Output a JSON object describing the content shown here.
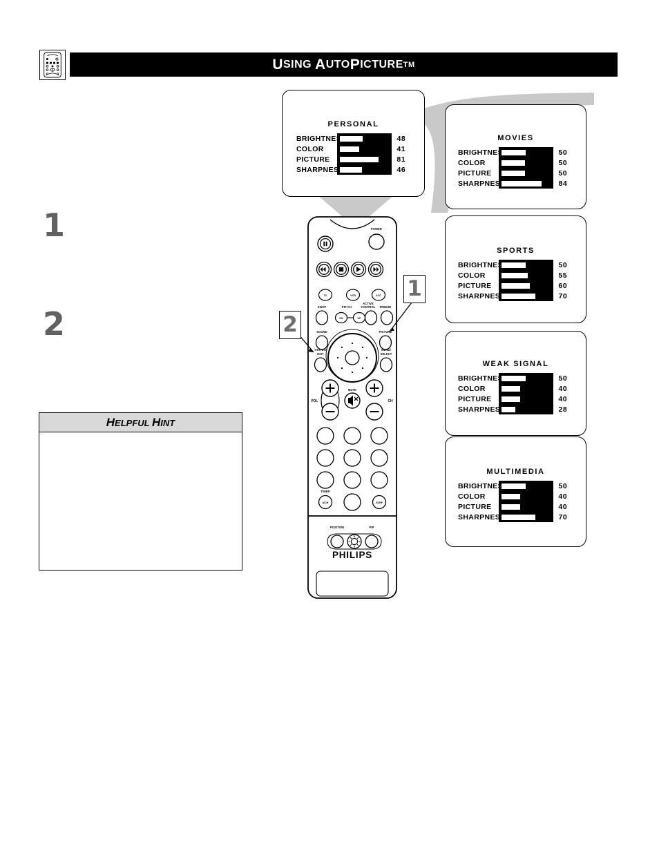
{
  "header": {
    "icon": "remote-control-icon",
    "title_parts": [
      "U",
      "SING ",
      "A",
      "UTO",
      "P",
      "ICTURE"
    ],
    "title": "USING AUTOPICTURE",
    "trademark": "TM",
    "bar_color": "#000000",
    "text_color": "#ffffff"
  },
  "steps": [
    {
      "number": "1",
      "text": ""
    },
    {
      "number": "2",
      "text": ""
    }
  ],
  "hint": {
    "title_parts": [
      "H",
      "ELPFUL ",
      "H",
      "INT"
    ],
    "title": "HELPFUL HINT",
    "body": "",
    "header_bg": "#d9d9d9"
  },
  "callouts": [
    {
      "label": "1",
      "target": "picture-button"
    },
    {
      "label": "2",
      "target": "status-exit-button"
    }
  ],
  "settings_columns": [
    "BRIGHTNESS",
    "COLOR",
    "PICTURE",
    "SHARPNESS"
  ],
  "panels": [
    {
      "id": "personal",
      "title": "PERSONAL",
      "rows": [
        {
          "label": "BRIGHTNESS",
          "value": 48
        },
        {
          "label": "COLOR",
          "value": 41
        },
        {
          "label": "PICTURE",
          "value": 81
        },
        {
          "label": "SHARPNESS",
          "value": 46
        }
      ]
    },
    {
      "id": "movies",
      "title": "MOVIES",
      "rows": [
        {
          "label": "BRIGHTNESS",
          "value": 50
        },
        {
          "label": "COLOR",
          "value": 50
        },
        {
          "label": "PICTURE",
          "value": 50
        },
        {
          "label": "SHARPNESS",
          "value": 84
        }
      ]
    },
    {
      "id": "sports",
      "title": "SPORTS",
      "rows": [
        {
          "label": "BRIGHTNESS",
          "value": 50
        },
        {
          "label": "COLOR",
          "value": 55
        },
        {
          "label": "PICTURE",
          "value": 60
        },
        {
          "label": "SHARPNESS",
          "value": 70
        }
      ]
    },
    {
      "id": "weak-signal",
      "title": "WEAK  SIGNAL",
      "rows": [
        {
          "label": "BRIGHTNESS",
          "value": 50
        },
        {
          "label": "COLOR",
          "value": 40
        },
        {
          "label": "PICTURE",
          "value": 40
        },
        {
          "label": "SHARPNESS",
          "value": 28
        }
      ]
    },
    {
      "id": "multimedia",
      "title": "MULTIMEDIA",
      "rows": [
        {
          "label": "BRIGHTNESS",
          "value": 50
        },
        {
          "label": "COLOR",
          "value": 40
        },
        {
          "label": "PICTURE",
          "value": 40
        },
        {
          "label": "SHARPNESS",
          "value": 70
        }
      ]
    }
  ],
  "remote": {
    "brand": "PHILIPS",
    "labels": {
      "power": "POWER",
      "tv": "TV",
      "vcr": "VCR",
      "acc": "ACC",
      "swap": "SWAP",
      "pip_ch": "PIP CH",
      "dn": "DN",
      "up": "UP",
      "active_control_1": "ACTIVE",
      "active_control_2": "CONTROL",
      "freeze": "FREEZE",
      "sound": "SOUND",
      "picture": "PICTURE",
      "status_1": "STATUS/",
      "status_2": "EXIT",
      "menu_1": "MENU/",
      "menu_2": "SELECT",
      "vol": "VOL",
      "ch": "CH",
      "mute": "MUTE",
      "timer": "TIMER",
      "ach": "A/CH",
      "surf": "SURF",
      "position": "POSITION",
      "pip": "PIP"
    }
  },
  "colors": {
    "gray_accent": "#c9c9c9",
    "step_number": "#616161",
    "callout_number": "#6e6e6e",
    "black": "#000000",
    "white": "#ffffff"
  }
}
